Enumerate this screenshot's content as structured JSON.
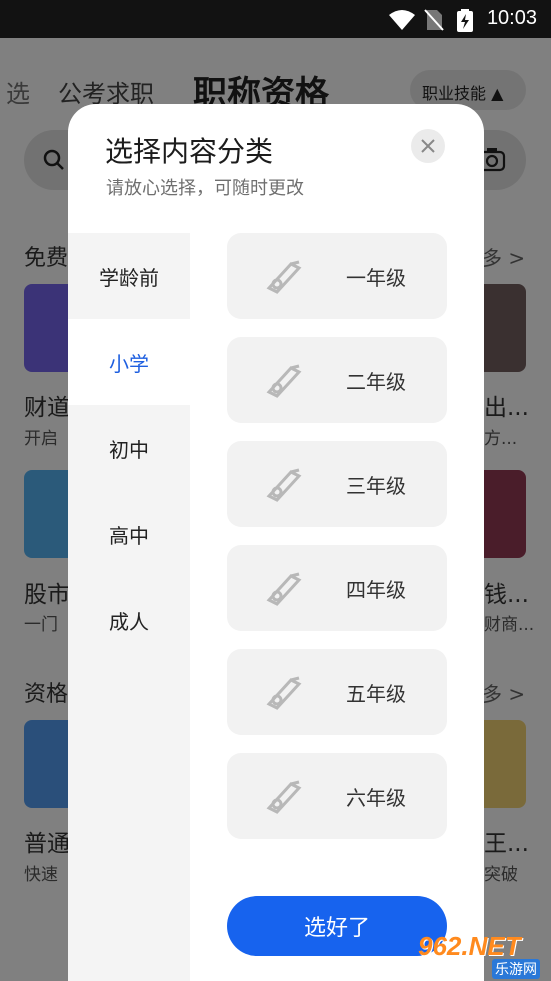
{
  "status_bar": {
    "time": "10:03",
    "icons": [
      "wifi-icon",
      "no-sim-icon",
      "battery-charging-icon"
    ]
  },
  "background": {
    "tabs": [
      "选",
      "公考求职",
      "职称资格"
    ],
    "skill_dropdown": "职业技能 ▲",
    "sections": [
      {
        "title": "免费",
        "more": "多 >"
      },
      {
        "title": "资格",
        "more": "多 >"
      }
    ],
    "rows": [
      {
        "left_title": "财道",
        "left_sub": "开启",
        "right_title": "出...",
        "right_sub": "方..."
      },
      {
        "left_title": "股市",
        "left_sub": "一门",
        "right_title": "钱...",
        "right_sub": "财商..."
      },
      {
        "left_title": "普通",
        "left_sub": "快速",
        "right_title": "王...",
        "right_sub": "突破"
      }
    ]
  },
  "modal": {
    "title": "选择内容分类",
    "subtitle": "请放心选择，可随时更改",
    "categories": [
      "学龄前",
      "小学",
      "初中",
      "高中",
      "成人"
    ],
    "selected_category": "小学",
    "grades": [
      "一年级",
      "二年级",
      "三年级",
      "四年级",
      "五年级",
      "六年级"
    ],
    "confirm_label": "选好了"
  },
  "watermark": {
    "brand": "962.NET",
    "text": "乐游网"
  },
  "colors": {
    "accent": "#1763ee",
    "selected_text": "#1e5fe0",
    "overlay": "#808080"
  }
}
